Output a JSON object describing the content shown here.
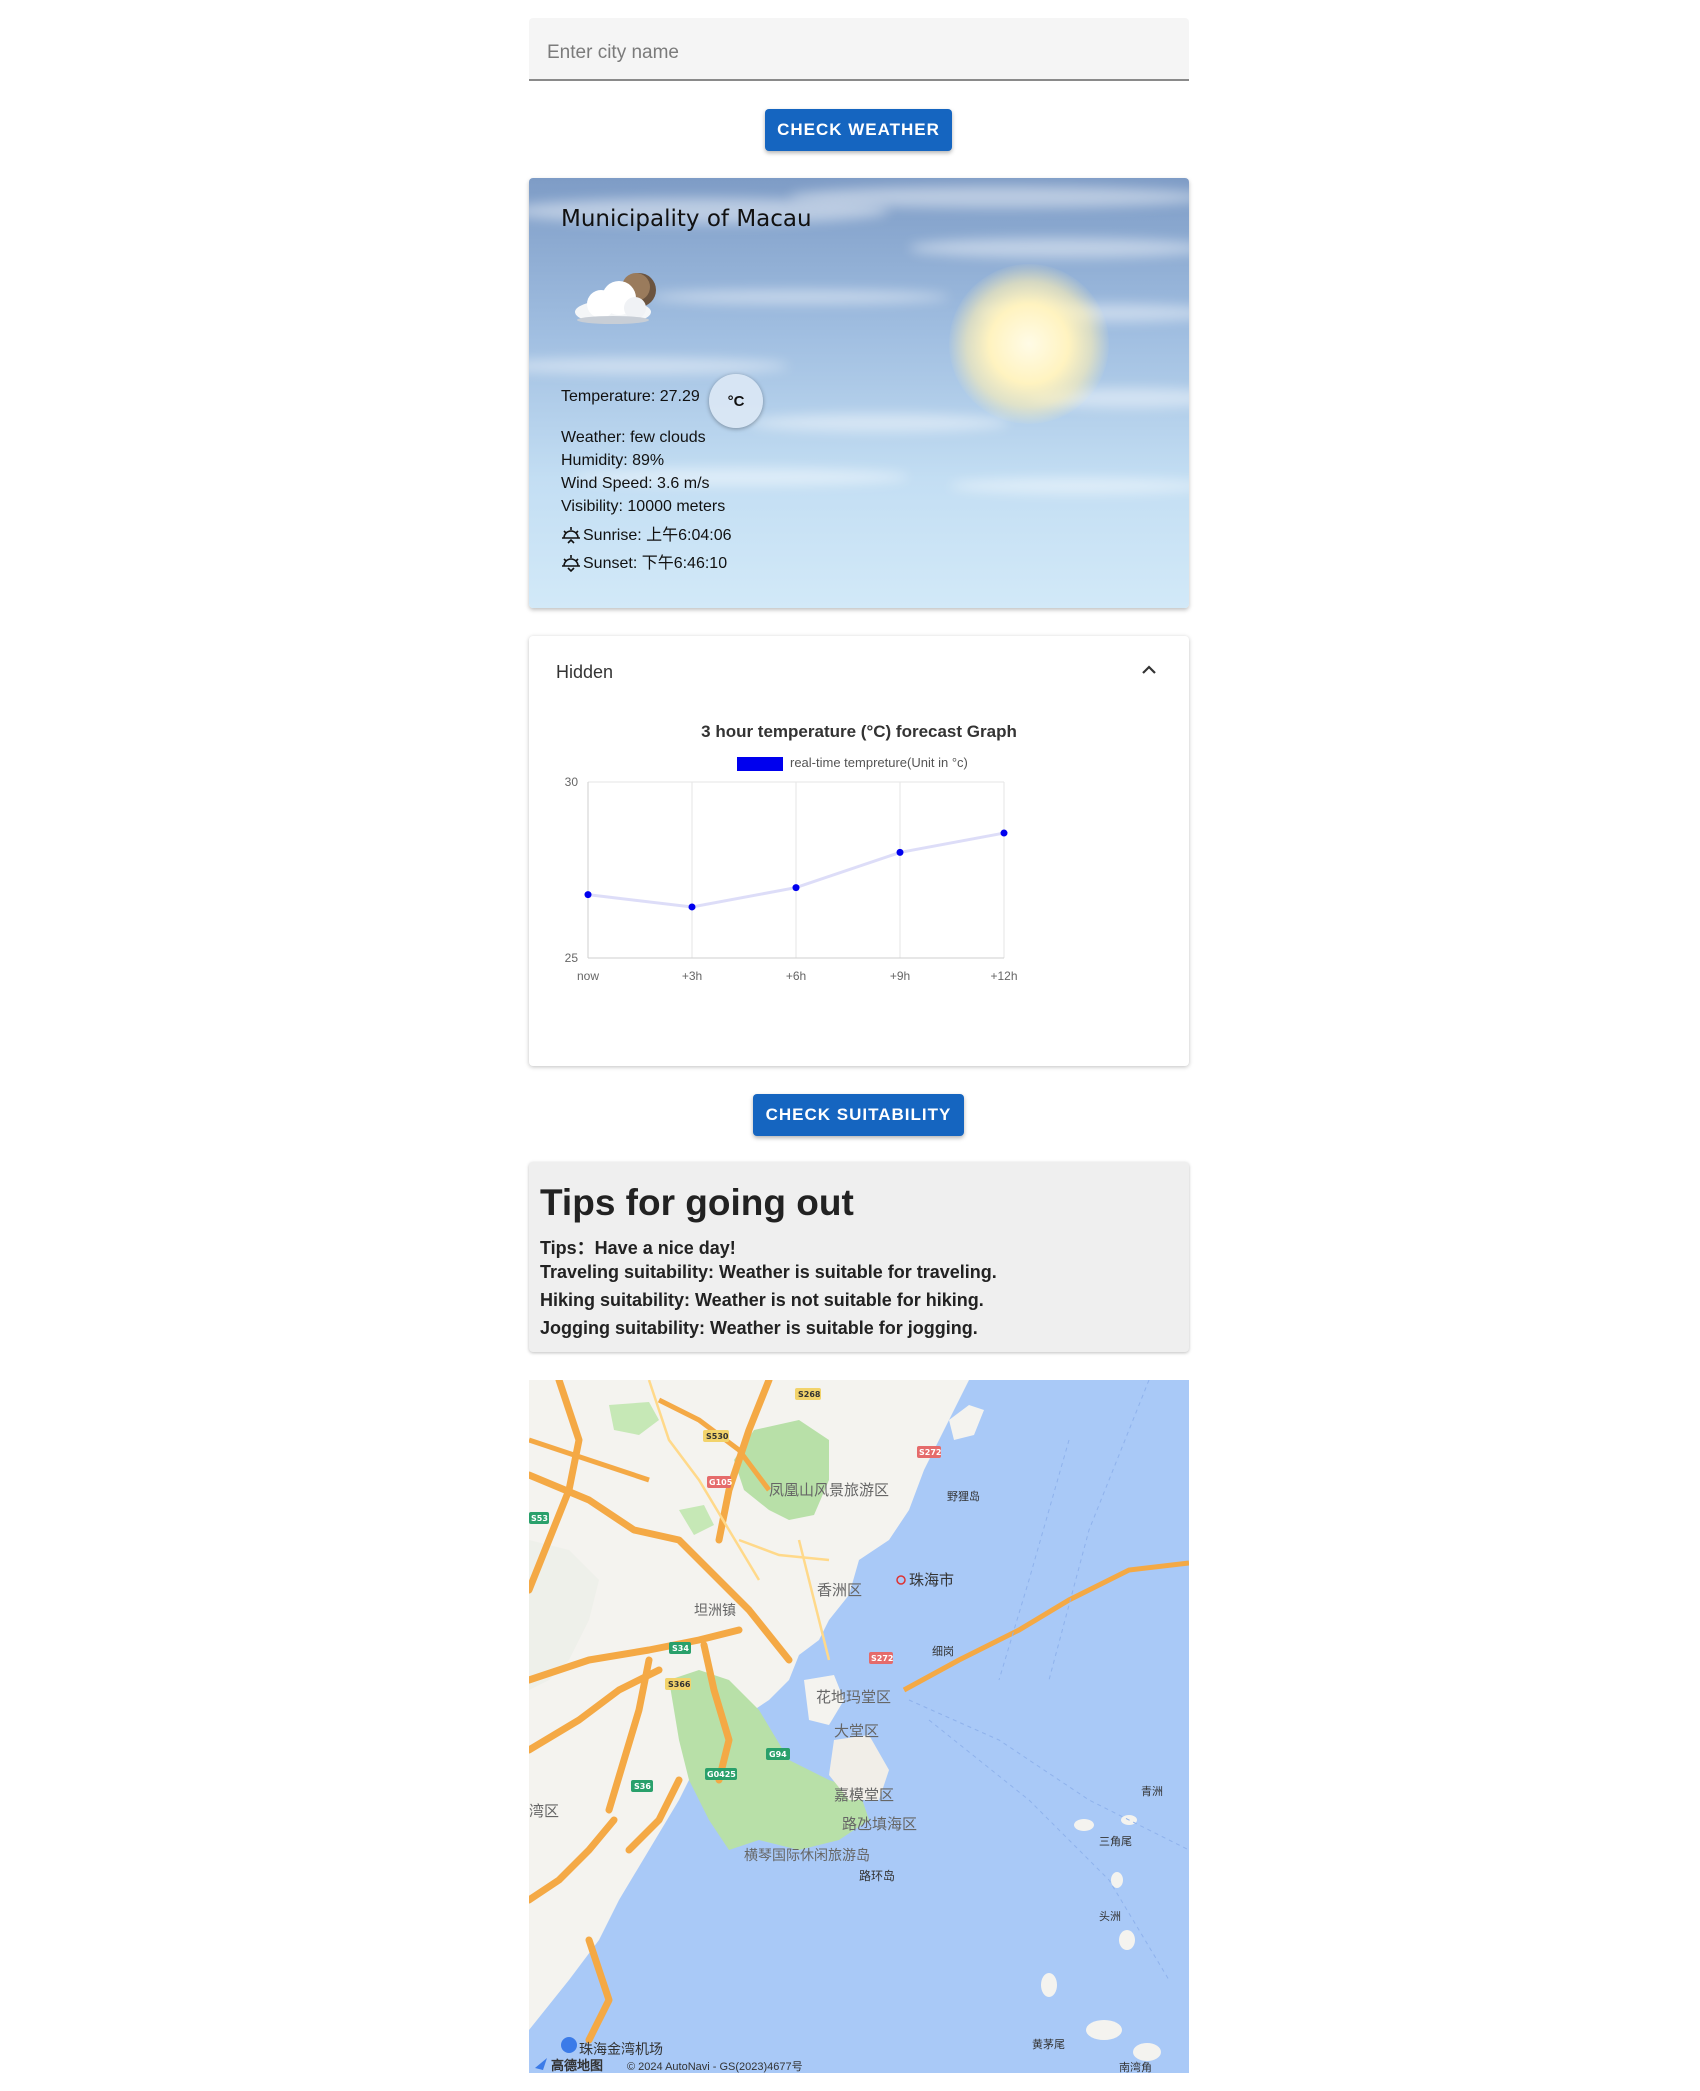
{
  "search": {
    "placeholder": "Enter city name",
    "value": ""
  },
  "check_weather_label": "CHECK WEATHER",
  "weather": {
    "city": "Municipality of Macau",
    "icon": "few-clouds-icon",
    "temperature": "Temperature: 27.29",
    "unit_toggle": "°C",
    "weather": "Weather: few clouds",
    "humidity": "Humidity: 89%",
    "wind": "Wind Speed: 3.6 m/s",
    "visibility": "Visibility: 10000 meters",
    "sunrise": "Sunrise: 上午6:04:06",
    "sunset": "Sunset: 下午6:46:10"
  },
  "forecast": {
    "toggle_label": "Hidden",
    "toggle_icon": "chevron-up-icon"
  },
  "chart_data": {
    "type": "line",
    "title": "3 hour temperature (°C) forecast Graph",
    "categories": [
      "now",
      "+3h",
      "+6h",
      "+9h",
      "+12h"
    ],
    "series": [
      {
        "name": "real-time tempreture(Unit in °c)",
        "values": [
          26.8,
          26.45,
          27.0,
          28.0,
          28.55
        ],
        "color": "#0000ee"
      }
    ],
    "ylim": [
      25,
      30
    ],
    "yticks": [
      "25",
      "30"
    ],
    "grid": true,
    "legend": "top"
  },
  "check_suitability_label": "CHECK SUITABILITY",
  "tips": {
    "heading": "Tips for going out",
    "lines": [
      "Tips：Have a nice day!",
      "Traveling suitability: Weather is suitable for traveling.",
      "Hiking suitability: Weather is not suitable for hiking.",
      "Jogging suitability: Weather is suitable for jogging."
    ]
  },
  "map": {
    "labels": [
      "凤凰山风景旅游区",
      "珠海市",
      "香洲区",
      "坦洲镇",
      "花地玛堂区",
      "大堂区",
      "嘉模堂区",
      "路氹填海区",
      "横琴国际休闲旅游岛",
      "路环岛",
      "湾区",
      "青洲",
      "三角尾",
      "头洲",
      "黄茅尾",
      "南湾角",
      "细岗",
      "野狸岛",
      "珠海金湾机场"
    ],
    "road_shields": [
      "S268",
      "S530",
      "G105",
      "S272",
      "S53",
      "S34",
      "S366",
      "G94",
      "S36",
      "G0425",
      "S272"
    ],
    "logo": "高德地图",
    "attribution": "© 2024 AutoNavi - GS(2023)4677号"
  }
}
